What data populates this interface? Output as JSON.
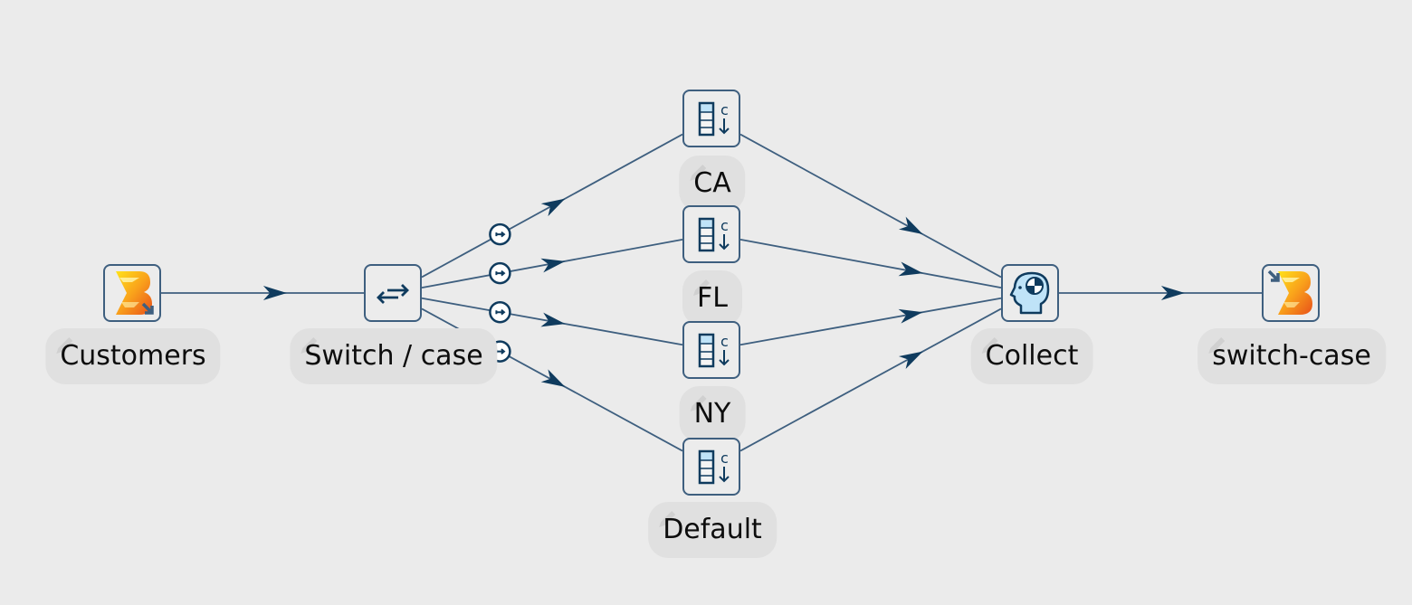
{
  "pipeline": {
    "nodes": [
      {
        "id": "customers",
        "label": "Customers",
        "type": "input",
        "icon": "beam-input-icon"
      },
      {
        "id": "switch",
        "label": "Switch / case",
        "type": "switch",
        "icon": "switch-arrows-icon"
      },
      {
        "id": "ca",
        "label": "CA",
        "type": "add-constant",
        "icon": "add-constant-column-icon"
      },
      {
        "id": "fl",
        "label": "FL",
        "type": "add-constant",
        "icon": "add-constant-column-icon"
      },
      {
        "id": "ny",
        "label": "NY",
        "type": "add-constant",
        "icon": "add-constant-column-icon"
      },
      {
        "id": "default",
        "label": "Default",
        "type": "add-constant",
        "icon": "add-constant-column-icon"
      },
      {
        "id": "collect",
        "label": "Collect",
        "type": "dummy",
        "icon": "head-target-icon"
      },
      {
        "id": "output",
        "label": "switch-case",
        "type": "output",
        "icon": "beam-output-icon"
      }
    ],
    "hops": [
      {
        "from": "customers",
        "to": "switch",
        "kind": "normal"
      },
      {
        "from": "switch",
        "to": "ca",
        "kind": "target"
      },
      {
        "from": "switch",
        "to": "fl",
        "kind": "target"
      },
      {
        "from": "switch",
        "to": "ny",
        "kind": "target"
      },
      {
        "from": "switch",
        "to": "default",
        "kind": "target"
      },
      {
        "from": "ca",
        "to": "collect",
        "kind": "normal"
      },
      {
        "from": "fl",
        "to": "collect",
        "kind": "normal"
      },
      {
        "from": "ny",
        "to": "collect",
        "kind": "normal"
      },
      {
        "from": "default",
        "to": "collect",
        "kind": "normal"
      },
      {
        "from": "collect",
        "to": "output",
        "kind": "normal"
      }
    ]
  },
  "colors": {
    "background": "#ebebeb",
    "hop": "#3e5f7f",
    "arrow": "#0f3b5e",
    "node_border": "#3e5f7f",
    "label_bg": "#e0e0e0"
  }
}
